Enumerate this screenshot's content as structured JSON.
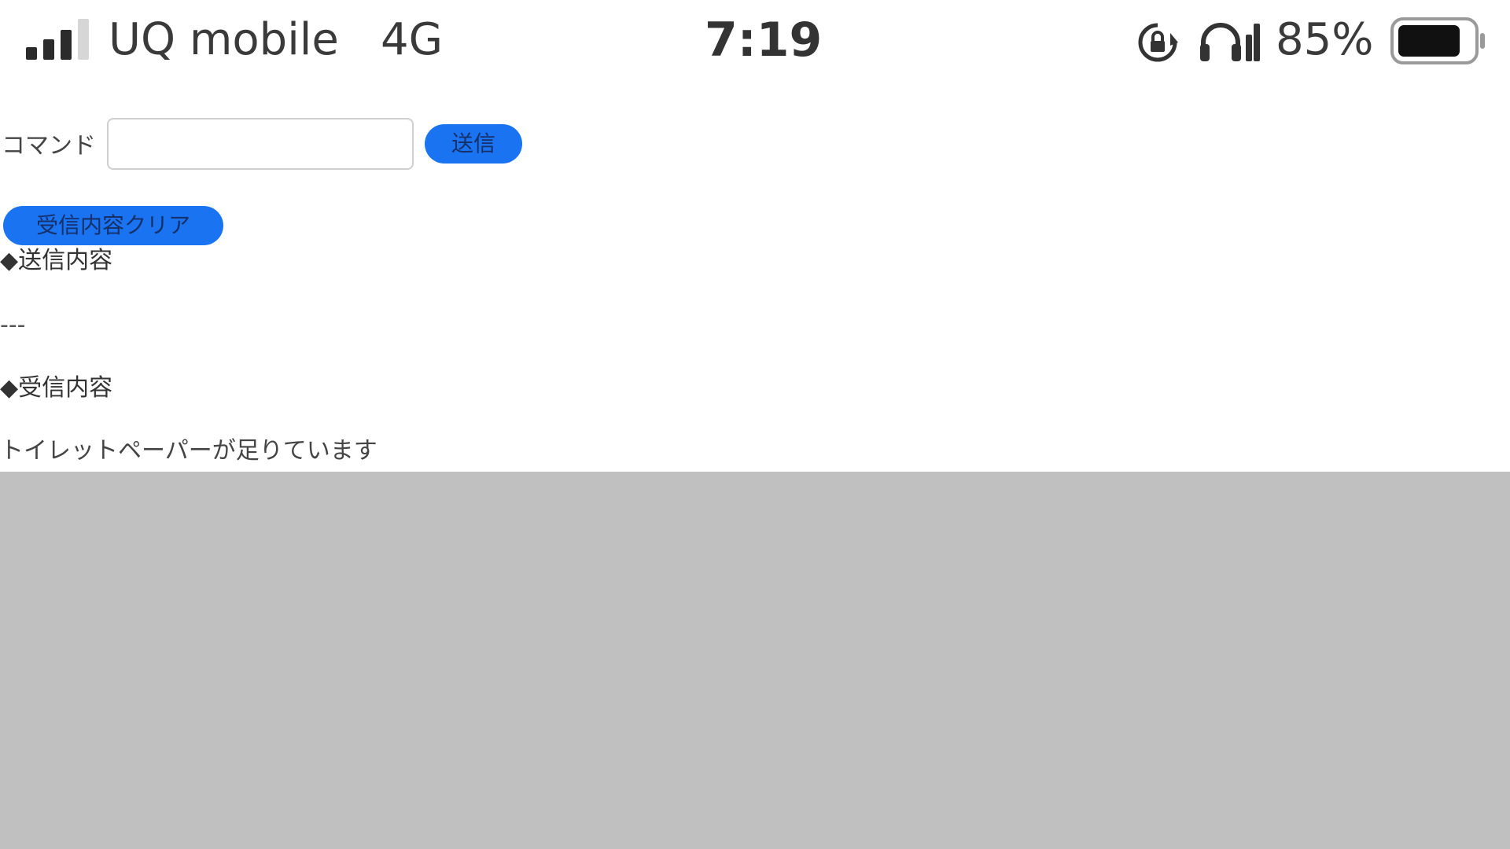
{
  "status_bar": {
    "carrier": "UQ mobile",
    "network": "4G",
    "time": "7:19",
    "battery_percent": "85%",
    "battery_level": 0.85,
    "signal_bars_filled": 3,
    "signal_bars_total": 4,
    "icons": [
      "signal-icon",
      "rotation-lock-icon",
      "headphone-icon",
      "battery-icon"
    ]
  },
  "form": {
    "command_label": "コマンド",
    "command_value": "",
    "command_placeholder": "",
    "send_button": "送信",
    "clear_button": "受信内容クリア"
  },
  "sent_section": {
    "heading": "◆送信内容",
    "body": "---"
  },
  "received_section": {
    "heading": "◆受信内容",
    "body": "トイレットペーパーが足りています"
  },
  "colors": {
    "button_bg": "#1a73f0",
    "gray_area": "#c0c0c0"
  }
}
